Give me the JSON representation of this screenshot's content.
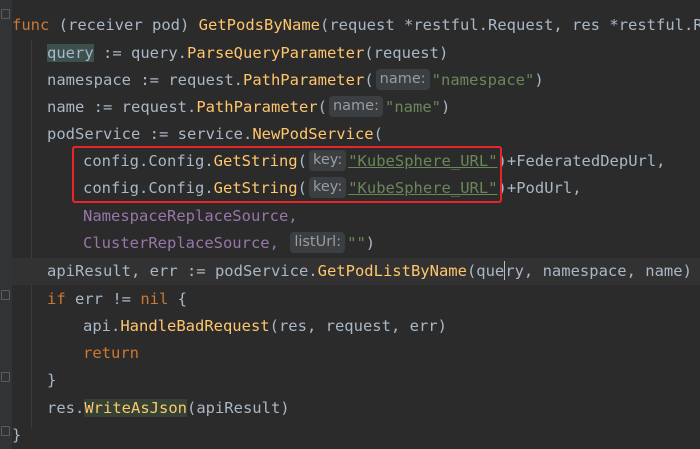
{
  "editor": {
    "lines": [
      {
        "t": "func (receiver pod) GetPodsByName(request *restful.Request, res *restful.Resp"
      },
      {
        "t": "query := query.ParseQueryParameter(request)"
      },
      {
        "t": "namespace := request.PathParameter("
      },
      {
        "t": "name := request.PathParameter("
      },
      {
        "t": "podService := service.NewPodService("
      },
      {
        "t": "config.Config.GetString("
      },
      {
        "t": "config.Config.GetString("
      },
      {
        "t": "NamespaceReplaceSource,"
      },
      {
        "t": "ClusterReplaceSource,"
      },
      {
        "t": "apiResult, err := podService.GetPodListByName(query, namespace, name)"
      },
      {
        "t": "if err != nil {"
      },
      {
        "t": "api.HandleBadRequest(res, request, err)"
      },
      {
        "t": "return"
      },
      {
        "t": "}"
      },
      {
        "t": "res.WriteAsJson(apiResult)"
      },
      {
        "t": "}"
      }
    ],
    "hints": {
      "name": "name:",
      "key": "key:",
      "listUrl": "listUrl:"
    },
    "strings": {
      "namespace": "\"namespace\"",
      "name": "\"name\"",
      "kubesphere_url": "\"KubeSphere_URL\"",
      "empty": "\"\""
    },
    "tokens": {
      "func": "func",
      "receiver": "receiver",
      "pod": "pod",
      "get_pods_by_name": "GetPodsByName",
      "request": "request",
      "restful_request": "*restful.Request,",
      "res": "res",
      "restful_resp": "*restful.Resp",
      "query": "query",
      "assign": " := ",
      "query_pkg": "query.",
      "parse_query": "ParseQueryParameter",
      "request_arg": "(request)",
      "namespace_var": "namespace",
      "request_dot": "request.",
      "path_parameter": "PathParameter",
      "name_var": "name",
      "pod_service": "podService",
      "service_dot": "service.",
      "new_pod_service": "NewPodService",
      "config_dot": "config.",
      "config_type": "Config.",
      "get_string": "GetString",
      "federated": "+FederatedDepUrl,",
      "pod_url": "+PodUrl,",
      "ns_replace": "NamespaceReplaceSource,",
      "cluster_replace": "ClusterReplaceSource,",
      "api_result": "apiResult, err := podService.",
      "get_pod_list": "GetPodListByName",
      "call_args_pre": "(que",
      "call_args_post": "ry, namespace, name)",
      "if_kw": "if",
      "err_check": " err != ",
      "nil_kw": "nil",
      "open_brace": " {",
      "api_dot": "api.",
      "handle_bad": "HandleBadRequest",
      "handle_args": "(res, request, err)",
      "return_kw": "return",
      "close_brace": "}",
      "res_dot": "res.",
      "write_as_json": "WriteAsJson",
      "write_args": "(apiResult)"
    }
  },
  "colors": {
    "background": "#2b2b2b",
    "keyword": "#cc7832",
    "function": "#ffc66d",
    "string": "#6a8759",
    "text": "#a9b7c6",
    "annotation_box": "#e8262a"
  }
}
